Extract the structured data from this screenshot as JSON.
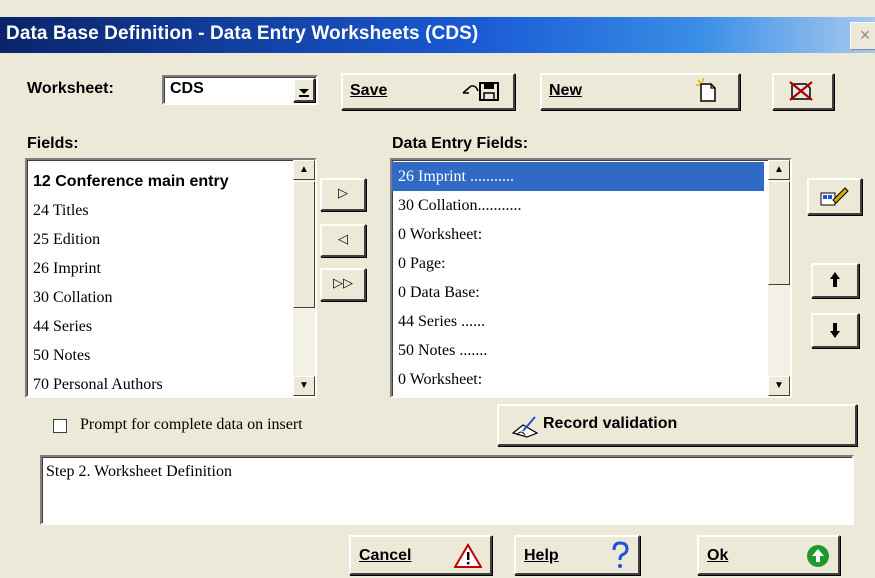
{
  "window": {
    "title": "Data Base Definition - Data Entry Worksheets (CDS)",
    "close_glyph": "×"
  },
  "worksheet": {
    "label": "Worksheet:",
    "value": "CDS"
  },
  "toolbar": {
    "save_label": "Save",
    "new_label": "New"
  },
  "fields": {
    "label": "Fields:",
    "items": [
      "12 Conference main entry",
      "24 Titles",
      "25 Edition",
      "26 Imprint",
      "30 Collation",
      "44 Series",
      "50 Notes",
      "70 Personal Authors"
    ]
  },
  "data_entry_fields": {
    "label": "Data Entry Fields:",
    "selected_index": 0,
    "items": [
      "26 Imprint ...........",
      "30 Collation...........",
      " 0 Worksheet:",
      " 0 Page:",
      " 0 Data Base:",
      "44 Series ......",
      "50 Notes .......",
      " 0 Worksheet:"
    ]
  },
  "transfer": {
    "add_glyph": "▷",
    "remove_glyph": "◁",
    "add_all_glyph": "▷▷"
  },
  "move": {
    "up_glyph": "🡅",
    "down_glyph": "🡇"
  },
  "prompt_checkbox": {
    "label": "Prompt for complete data on insert",
    "checked": false
  },
  "record_validation_label": "Record validation",
  "status_text": "Step 2. Worksheet Definition",
  "footer": {
    "cancel_label": "Cancel",
    "help_label": "Help",
    "ok_label": "Ok"
  },
  "colors": {
    "title_start": "#0a246a",
    "title_end": "#a6caf0",
    "selection": "#316ac5",
    "ok_icon": "#1f9a2a",
    "help_icon": "#1a55d8",
    "warn_icon": "#c00000"
  }
}
